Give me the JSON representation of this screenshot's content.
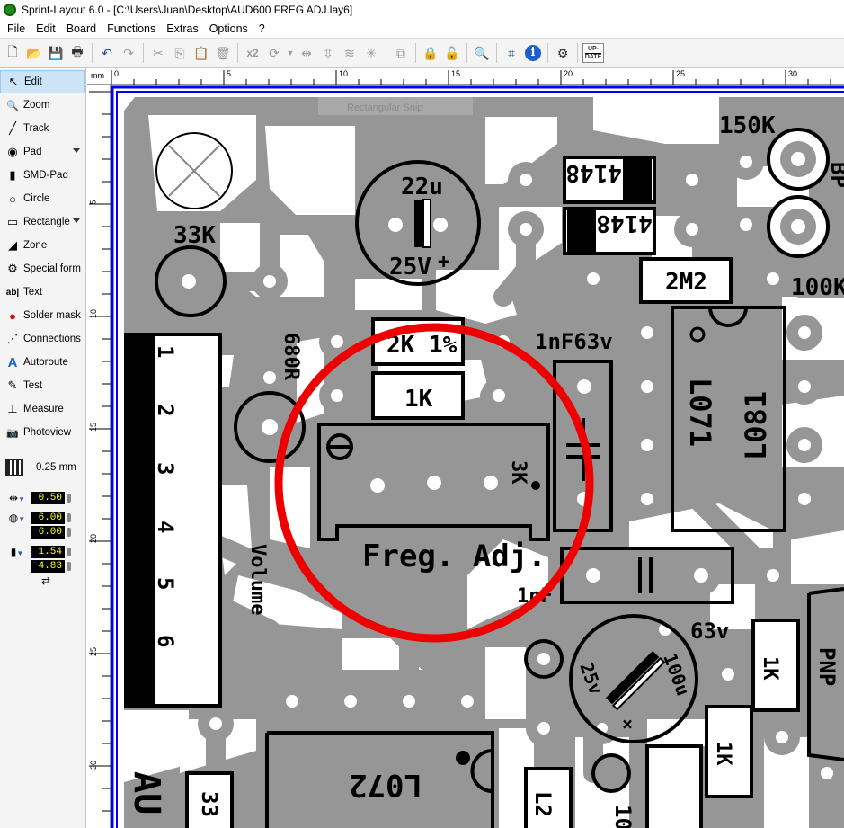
{
  "window": {
    "title": "Sprint-Layout 6.0 - [C:\\Users\\Juan\\Desktop\\AUD600 FREG ADJ.lay6]"
  },
  "menu": [
    "File",
    "Edit",
    "Board",
    "Functions",
    "Extras",
    "Options",
    "?"
  ],
  "toolbar": {
    "zoom_factor_label": "x2",
    "update_label_1": "UP-",
    "update_label_2": "DATE"
  },
  "tools": [
    {
      "label": "Edit",
      "icon": "cursor-icon",
      "glyph": "↖",
      "active": true
    },
    {
      "label": "Zoom",
      "icon": "magnifier-icon",
      "glyph": "🔍"
    },
    {
      "label": "Track",
      "icon": "track-icon",
      "glyph": "╱"
    },
    {
      "label": "Pad",
      "icon": "pad-icon",
      "glyph": "◉",
      "dropdown": true
    },
    {
      "label": "SMD-Pad",
      "icon": "smd-pad-icon",
      "glyph": "▮"
    },
    {
      "label": "Circle",
      "icon": "circle-icon",
      "glyph": "○"
    },
    {
      "label": "Rectangle",
      "icon": "rectangle-icon",
      "glyph": "▭",
      "dropdown": true
    },
    {
      "label": "Zone",
      "icon": "zone-icon",
      "glyph": "◢"
    },
    {
      "label": "Special form",
      "icon": "special-form-icon",
      "glyph": "⚙"
    },
    {
      "label": "Text",
      "icon": "text-icon",
      "glyph": "ab|"
    },
    {
      "label": "Solder mask",
      "icon": "solder-mask-icon",
      "glyph": "●"
    },
    {
      "label": "Connections",
      "icon": "connections-icon",
      "glyph": "⋰"
    },
    {
      "label": "Autoroute",
      "icon": "autoroute-icon",
      "glyph": "A"
    },
    {
      "label": "Test",
      "icon": "test-icon",
      "glyph": "✎"
    },
    {
      "label": "Measure",
      "icon": "measure-icon",
      "glyph": "⊥"
    },
    {
      "label": "Photoview",
      "icon": "photoview-icon",
      "glyph": "📷"
    }
  ],
  "grid": {
    "value": "0.25 mm"
  },
  "track_width": "0.50",
  "pad_size": {
    "outer": "6.00",
    "inner": "6.00"
  },
  "smd_size": {
    "width": "1.54",
    "height": "4.83"
  },
  "ruler": {
    "unit": "mm",
    "top_ticks": [
      "0",
      "5",
      "10",
      "15",
      "20",
      "25",
      "30"
    ],
    "left_ticks": [
      "5",
      "10",
      "15",
      "20",
      "25",
      "30"
    ]
  },
  "canvas": {
    "ghost_label": "Rectangular Snip",
    "component_labels": {
      "r33k": "33K",
      "cap22u": "22u",
      "cap25v": "25V",
      "plus": "+",
      "diode1": "4148",
      "diode2": "4148",
      "r150k": "150K",
      "r2m2": "2M2",
      "r100k": "100K",
      "r680r": "680R",
      "r2k": "2K 1%",
      "r1k": "1K",
      "c1nf63v": "1nF63v",
      "ic_l071": "L071",
      "ic_l081": "L081",
      "pot3k": "3K",
      "freq_adj": "Freg. Adj.",
      "c1nf": "1nF",
      "c63v": "63v",
      "cap100u": "100u",
      "cap25v_b": "25v",
      "minus": "×",
      "r1k_b": "1K",
      "r1k_c": "1K",
      "pnp": "PNP",
      "ic_l072": "L072",
      "conn_pins": [
        "1",
        "2",
        "3",
        "4",
        "5",
        "6"
      ],
      "volume": "Volume",
      "r33_b": "33",
      "au": "AU",
      "l2": "L2",
      "ten": "10",
      "bp": "BP"
    },
    "colors": {
      "copper": "#969696",
      "silk": "#000000",
      "highlight": "#ee0000",
      "board_border": "#0000ff"
    }
  }
}
